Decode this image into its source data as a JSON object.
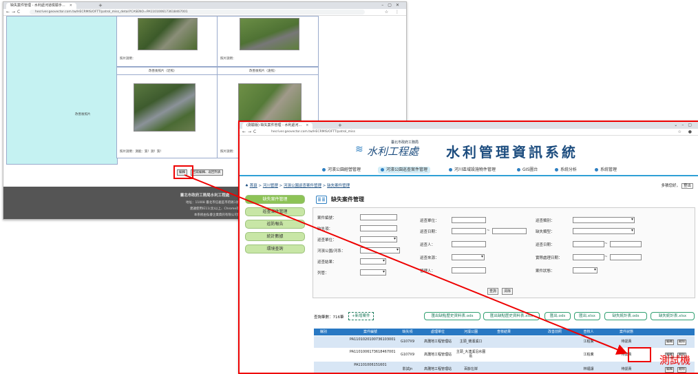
{
  "back_window": {
    "tab_title": "缺失案件管理 - 水利處河道檢驗手...",
    "url": "hecriver.geovector.com.tw/HECRMIS/OFTT/patrol_miss_detail?CASENO=PA1101006173618467001",
    "photo_caption_1": "照片說明：",
    "photo_caption_2": "照片說明：",
    "after_photos_label": "改善後照片",
    "after_near_header": "改善後照片（近照）",
    "after_far_header": "改善後照片（遠照）",
    "after_caption_1": "照片說明：測能：質！測！質！",
    "after_caption_2": "照片說明：",
    "buttons": {
      "edit": "編輯",
      "other": "回寫編輯、返回列表"
    },
    "footer": {
      "title": "臺北市政府工務局水利工程處",
      "line1": "地址：11008 臺北市信義區市府路1號(市府大樓)北區 臺北市民服務熱線",
      "line2": "建議使用IE11(含)以上、Chrome或Firefox版本瀏覽器 瀏覽人次：",
      "line3": "本系統由弘睿企業資訊有限公司開發維護 TEL:(02)2792932"
    }
  },
  "front_window": {
    "tab_title": "(測驗版) 缺失案件管理 - 水利處河...",
    "url": "hecriver.geovector.com.tw/HECRMIS/OFTT/patrol_miss",
    "logo_subtitle": "臺北市政府工務局",
    "logo_name": "水利工程處",
    "system_title": "水利管理資訊系統",
    "menu": [
      "河濱公園經營管理",
      "河濱公園巡查案件管理",
      "河川區域設施物件管理",
      "GIS圖台",
      "系統分析",
      "系統管理"
    ],
    "breadcrumb": [
      "首頁",
      "河川管理",
      "河濱公園巡查案件管理",
      "缺失案件管理"
    ],
    "greeting": "多積您好，",
    "logout": "登出",
    "sidebar": [
      "缺失案件管理",
      "巡查案件管理",
      "巡防報告",
      "統計數據",
      "環境查詢"
    ],
    "page_title": "缺失案件管理",
    "form": {
      "col1": [
        "案件編號：",
        "缺失項：",
        "巡查單位：",
        "河濱公園/河系：",
        "巡查結果：",
        "列管："
      ],
      "col2": [
        "巡查單位：",
        "巡查日期：",
        "巡查人：",
        "巡查來源：",
        "管理人："
      ],
      "col3": [
        "巡查類別：",
        "缺失類型：",
        "巡查日期：",
        "實際處理日期：",
        "案件狀態："
      ],
      "range_sep": "~",
      "search": "查詢",
      "clear": "清除"
    },
    "result_count": "查詢筆數：716筆",
    "add_case": "+新增案件",
    "export_buttons": [
      "匯出缺點歷史資料表.ods",
      "匯出缺點歷史資料表.xlsx",
      "匯出.ods",
      "匯出.xlsx",
      "缺失統計表.ods",
      "缺失統計表.xlsx"
    ],
    "table": {
      "headers": [
        "縣別",
        "案件編號",
        "缺失項",
        "處理單位",
        "河濱公園",
        "查核結果",
        "改善前照",
        "查核人",
        "案件狀態",
        ""
      ],
      "rows": [
        {
          "case": "PA1101020100736103001",
          "code": "G107X9",
          "unit": "高灘地工程管理站",
          "park": "主頭_環濱溪口",
          "person": "江柏廣",
          "status": "待認責",
          "edit": "編輯",
          "del": "刪除"
        },
        {
          "case": "PA1101006173618467001",
          "code": "G107X9",
          "unit": "高灘地工程管理站",
          "park": "主頭_大澳溪沿水圍區",
          "person": "江柏廣",
          "status": "待認責",
          "edit": "編輯",
          "del": "刪除"
        },
        {
          "case": "PA1101006151601",
          "code": "影試jn",
          "unit": "高灘地工程管理站",
          "park": "百齡左岸",
          "person": "林福讓",
          "status": "待認責",
          "edit": "編輯",
          "del": "刪除"
        }
      ]
    }
  },
  "annotation": "測試機",
  "colors": {
    "highlight": "#ee0000",
    "accent": "#2e7fc1",
    "sidebar": "#8dc356"
  }
}
